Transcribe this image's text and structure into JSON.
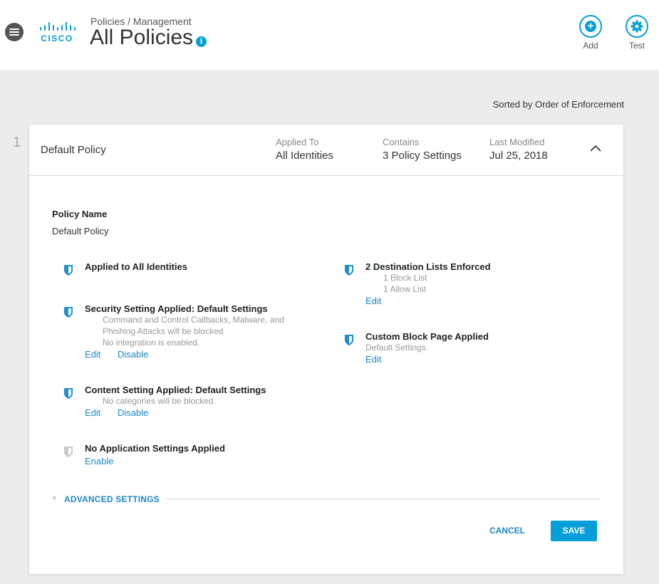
{
  "header": {
    "breadcrumb": "Policies / Management",
    "title": "All Policies",
    "logo_text": "CISCO",
    "info_glyph": "i",
    "add_label": "Add",
    "test_label": "Test",
    "add_glyph": "+"
  },
  "sort_label": "Sorted by Order of Enforcement",
  "policy": {
    "index": "1",
    "name": "Default Policy",
    "applied_to": {
      "key": "Applied To",
      "value": "All Identities"
    },
    "contains": {
      "key": "Contains",
      "value": "3 Policy Settings"
    },
    "last_modified": {
      "key": "Last Modified",
      "value": "Jul 25, 2018"
    }
  },
  "body": {
    "policy_name_label": "Policy Name",
    "policy_name_value": "Default Policy",
    "settings": {
      "identities": {
        "title": "Applied to All Identities"
      },
      "security": {
        "title": "Security Setting Applied: Default Settings",
        "desc": [
          "Command and Control Callbacks, Malware, and",
          "Phishing Attacks will be blocked",
          "No integration is enabled."
        ],
        "edit": "Edit",
        "disable": "Disable"
      },
      "content": {
        "title": "Content Setting Applied: Default Settings",
        "desc": "No categories will be blocked.",
        "edit": "Edit",
        "disable": "Disable"
      },
      "application": {
        "title": "No Application Settings Applied",
        "enable": "Enable"
      },
      "destinations": {
        "title": "2 Destination Lists Enforced",
        "desc": [
          "1 Block List",
          "1 Allow List"
        ],
        "edit": "Edit"
      },
      "block_page": {
        "title": "Custom Block Page Applied",
        "desc": "Default Settings",
        "edit": "Edit"
      }
    },
    "advanced_label": "ADVANCED SETTINGS",
    "cancel_label": "CANCEL",
    "save_label": "SAVE"
  },
  "icons": {
    "menu": "menu-icon",
    "logo": "cisco-logo",
    "add": "add-circle-icon",
    "test": "gear-icon",
    "collapse": "chevron-up-icon",
    "shield": "shield-icon",
    "advanced": "caret-right-icon"
  },
  "colors": {
    "accent": "#049fd9",
    "link": "#1e88c7",
    "shield_active": "#1e8fce",
    "shield_inactive": "#c8c8c8",
    "page_bg": "#ececec"
  }
}
